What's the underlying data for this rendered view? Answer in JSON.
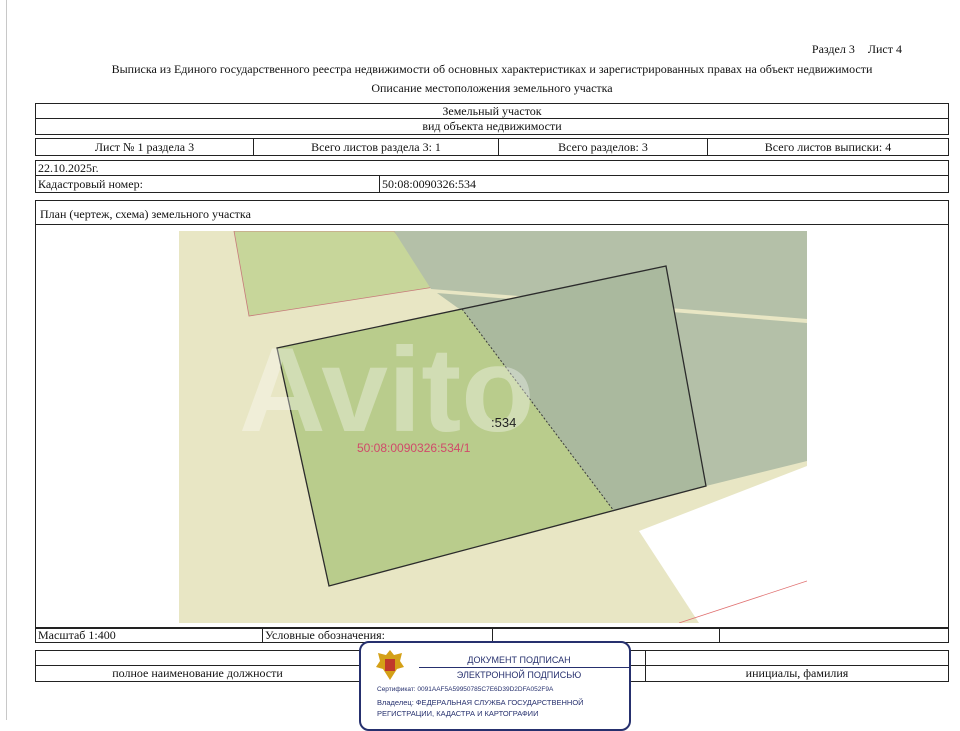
{
  "header": {
    "section": "Раздел 3",
    "sheet": "Лист 4",
    "title": "Выписка из Единого государственного реестра недвижимости об основных характеристиках и зарегистрированных правах на объект недвижимости",
    "subtitle": "Описание местоположения земельного участка"
  },
  "object": {
    "type": "Земельный участок",
    "type_caption": "вид объекта недвижимости"
  },
  "sheets_row": {
    "sheet_of_section": "Лист № 1 раздела 3",
    "total_section_sheets": "Всего листов раздела 3: 1",
    "total_sections": "Всего разделов: 3",
    "total_extract_sheets": "Всего листов выписки: 4"
  },
  "date": "22.10.2025г.",
  "cadastral": {
    "label": "Кадастровый номер:",
    "value": "50:08:0090326:534"
  },
  "plan": {
    "label": "План (чертеж, схема) земельного участка",
    "parcel_label": ":534",
    "sub_parcel_label": "50:08:0090326:534/1",
    "watermark": "Avito"
  },
  "legend": {
    "scale": "Масштаб 1:400",
    "symbols": "Условные обозначения:"
  },
  "signature": {
    "position": "полное наименование должности",
    "initials": "инициалы, фамилия"
  },
  "stamp": {
    "line1": "ДОКУМЕНТ ПОДПИСАН",
    "line2": "ЭЛЕКТРОННОЙ ПОДПИСЬЮ",
    "certificate": "Сертификат: 0091AAF5A59950785C7E6D39D2DFA052F9A",
    "owner_line1": "Владелец: ФЕДЕРАЛЬНАЯ СЛУЖБА ГОСУДАРСТВЕННОЙ",
    "owner_line2": "РЕГИСТРАЦИИ, КАДАСТРА И КАРТОГРАФИИ"
  },
  "colors": {
    "map_beige": "#e8e6c4",
    "parcel_green": "#b9cc8c",
    "neighbor_green": "#c7d69a",
    "grey_zone": "#b4c0a8",
    "label_red": "#d04a6a",
    "stamp_blue": "#26306e"
  }
}
